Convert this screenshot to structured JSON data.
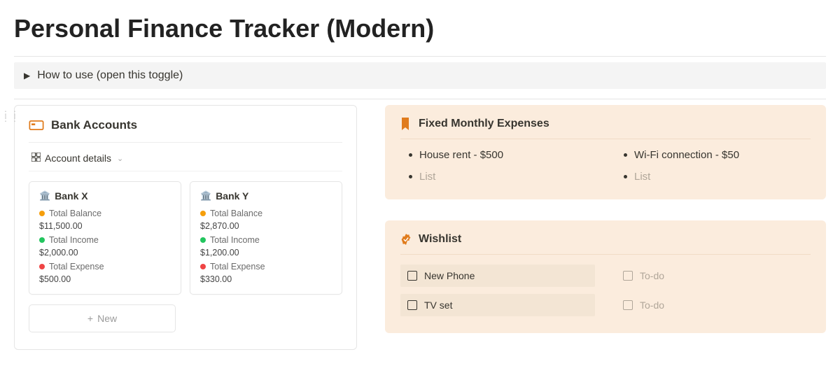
{
  "page": {
    "title": "Personal Finance Tracker (Modern)",
    "toggle_label": "How to use (open this toggle)"
  },
  "bank_accounts": {
    "header": "Bank Accounts",
    "view_label": "Account details",
    "new_label": "New",
    "stat_labels": {
      "balance": "Total Balance",
      "income": "Total Income",
      "expense": "Total Expense"
    },
    "accounts": [
      {
        "name": "Bank X",
        "balance": "$11,500.00",
        "income": "$2,000.00",
        "expense": "$500.00"
      },
      {
        "name": "Bank Y",
        "balance": "$2,870.00",
        "income": "$1,200.00",
        "expense": "$330.00"
      }
    ]
  },
  "fixed_expenses": {
    "header": "Fixed Monthly Expenses",
    "items": [
      {
        "text": "House rent - $500",
        "placeholder": false
      },
      {
        "text": "Wi-Fi connection - $50",
        "placeholder": false
      },
      {
        "text": "List",
        "placeholder": true
      },
      {
        "text": "List",
        "placeholder": true
      }
    ]
  },
  "wishlist": {
    "header": "Wishlist",
    "items": [
      {
        "text": "New Phone",
        "placeholder": false
      },
      {
        "text": "To-do",
        "placeholder": true
      },
      {
        "text": "TV set",
        "placeholder": false
      },
      {
        "text": "To-do",
        "placeholder": true
      }
    ]
  },
  "colors": {
    "accent_orange": "#e07b1c",
    "beige_bg": "#fbecdd"
  }
}
